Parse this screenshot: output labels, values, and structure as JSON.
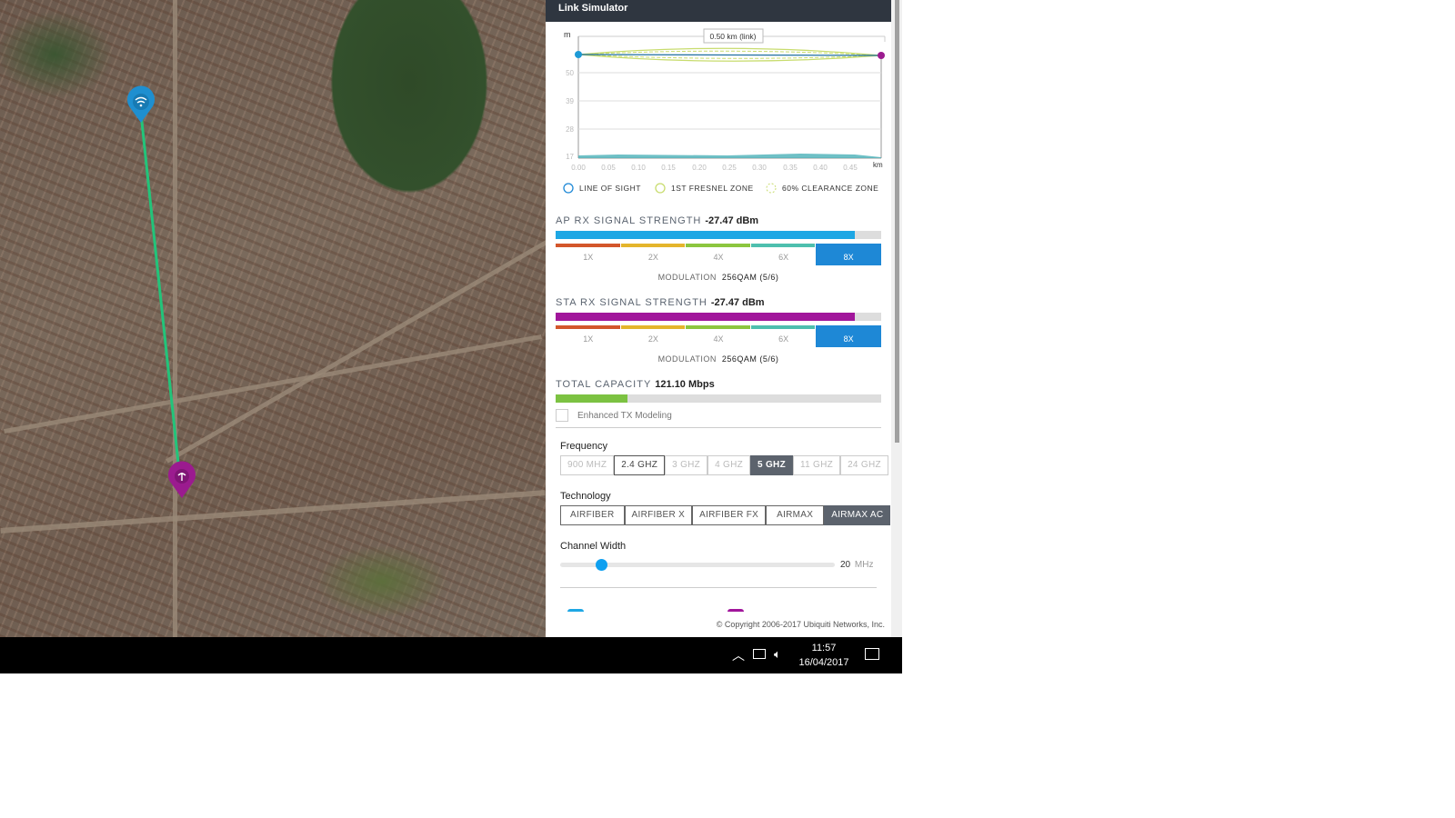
{
  "panel": {
    "title": "Link Simulator"
  },
  "chart": {
    "type": "area",
    "title": "0.50 km (link)",
    "ylabel": "m",
    "xlabel": "km",
    "yticks": [
      "50",
      "39",
      "28",
      "17"
    ],
    "xticks": [
      "0.00",
      "0.05",
      "0.10",
      "0.15",
      "0.20",
      "0.25",
      "0.30",
      "0.35",
      "0.40",
      "0.45"
    ],
    "legend": [
      "LINE OF SIGHT",
      "1ST FRESNEL ZONE",
      "60% CLEARANCE ZONE"
    ],
    "colors": {
      "los": "#1e88d6",
      "fresnel": "#c8dc6e",
      "terrain": "#4ab0b8",
      "ap": "#1e9ad6",
      "sta": "#9b1b8f"
    }
  },
  "ap": {
    "label": "AP RX SIGNAL STRENGTH",
    "value": "-27.47 dBm",
    "fill_pct": 92,
    "color": "#1ea7e4",
    "mods": [
      "1X",
      "2X",
      "4X",
      "6X",
      "8X"
    ],
    "active_mod": "8X",
    "mod_label": "MODULATION",
    "mod_value": "256QAM (5/6)"
  },
  "sta": {
    "label": "STA RX SIGNAL STRENGTH",
    "value": "-27.47 dBm",
    "fill_pct": 92,
    "color": "#a1169b",
    "mods": [
      "1X",
      "2X",
      "4X",
      "6X",
      "8X"
    ],
    "active_mod": "8X",
    "mod_label": "MODULATION",
    "mod_value": "256QAM (5/6)"
  },
  "capacity": {
    "label": "TOTAL CAPACITY",
    "value": "121.10 Mbps",
    "fill_pct": 22
  },
  "enhanced": {
    "label": "Enhanced TX Modeling",
    "checked": false
  },
  "frequency": {
    "label": "Frequency",
    "options": [
      "900 MHZ",
      "2.4 GHZ",
      "3 GHZ",
      "4 GHZ",
      "5 GHZ",
      "11 GHZ",
      "24 GHZ"
    ],
    "selected": "5 GHZ"
  },
  "technology": {
    "label": "Technology",
    "options": [
      "AIRFIBER",
      "AIRFIBER X",
      "AIRFIBER FX",
      "AIRMAX",
      "AIRMAX AC"
    ],
    "selected": "AIRMAX AC"
  },
  "channel": {
    "label": "Channel Width",
    "value": "20",
    "unit": "MHz",
    "slider_pct": 15
  },
  "footer": {
    "copyright": "© Copyright 2006-2017 Ubiquiti Networks, Inc."
  },
  "taskbar": {
    "time": "11:57",
    "date": "16/04/2017"
  }
}
